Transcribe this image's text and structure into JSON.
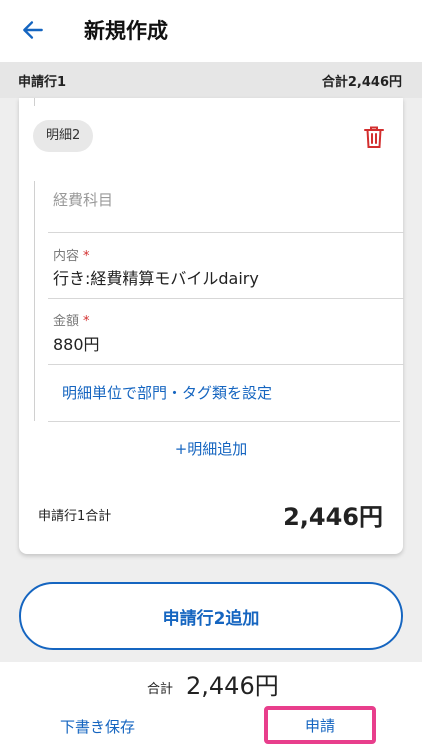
{
  "header": {
    "title": "新規作成",
    "back_icon": "arrow-left-icon"
  },
  "section": {
    "title": "申請行1",
    "total": "合計2,446円"
  },
  "detail": {
    "chip_label": "明細2",
    "delete_icon": "trash-icon",
    "delete_color": "#d32f2f",
    "expense_item_placeholder": "経費科目",
    "content_label": "内容",
    "content_value": "行き:経費精算モバイルdairy",
    "amount_label": "金額",
    "amount_value": "880円",
    "required_mark": "*",
    "setting_link": "明細単位で部門・タグ類を設定"
  },
  "add_detail": "+明細追加",
  "subtotal": {
    "label": "申請行1合計",
    "value": "2,446円"
  },
  "add_row_button": "申請行2追加",
  "footer": {
    "total_label": "合計",
    "total_value": "2,446円",
    "draft_button": "下書き保存",
    "submit_button": "申請"
  },
  "colors": {
    "accent": "#1565c0",
    "highlight": "#e83e8c"
  }
}
